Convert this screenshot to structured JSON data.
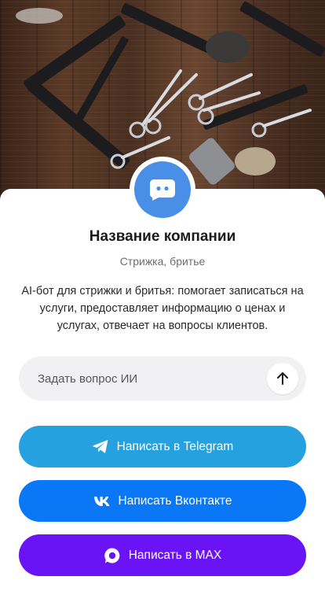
{
  "company": {
    "name": "Название компании",
    "category": "Стрижка, бритье",
    "description": "AI-бот для стрижки и бритья: помогает записаться на услуги, предоставляет информацию о ценах и услугах, отвечает на вопросы клиентов."
  },
  "ask": {
    "placeholder": "Задать вопрос ИИ",
    "send_icon": "arrow-up-icon"
  },
  "buttons": {
    "telegram": "Написать в Telegram",
    "vkontakte": "Написать Вконтакте",
    "max": "Написать в MAX"
  },
  "colors": {
    "avatar": "#4a8fe7",
    "telegram": "#26a1e0",
    "vkontakte": "#0a77f6",
    "max": "#6a13f4"
  },
  "icons": {
    "avatar": "chat-bot-icon",
    "telegram": "telegram-icon",
    "vkontakte": "vk-icon",
    "max": "max-icon"
  }
}
